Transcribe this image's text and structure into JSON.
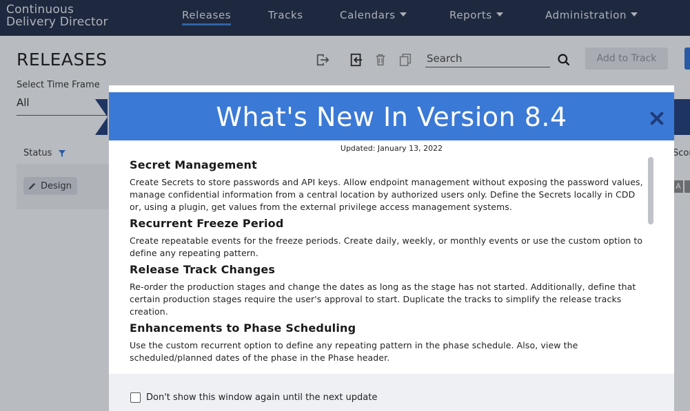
{
  "app": {
    "brand_line1": "Continuous",
    "brand_line2": "Delivery Director"
  },
  "nav": {
    "items": [
      {
        "label": "Releases",
        "active": true
      },
      {
        "label": "Tracks"
      },
      {
        "label": "Calendars",
        "dropdown": true
      },
      {
        "label": "Reports",
        "dropdown": true
      },
      {
        "label": "Administration",
        "dropdown": true
      }
    ]
  },
  "page": {
    "title": "RELEASES",
    "search_placeholder": "Search",
    "add_to_track": "Add to Track",
    "time_frame_label": "Select Time Frame",
    "time_frame_value": "All",
    "status_column": "Status",
    "score_column": "Scor",
    "row_status": "Design",
    "score_badge": "A"
  },
  "modal": {
    "title": "What's New In Version 8.4",
    "updated": "Updated: January 13, 2022",
    "sections": [
      {
        "title": "Secret Management",
        "body": "Create Secrets to store passwords and API keys. Allow endpoint management without exposing the password values, manage confidential information from a central location by authorized users only. Define the Secrets locally in CDD or, using a plugin, get values from the external privilege access management systems."
      },
      {
        "title": "Recurrent Freeze Period",
        "body": "Create repeatable events for the freeze periods. Create daily, weekly, or monthly events or use the custom option to define any repeating pattern."
      },
      {
        "title": "Release Track Changes",
        "body": "Re-order the production stages and change the dates as long as the stage has not started. Additionally, define that certain production stages require the user's approval to start. Duplicate the tracks to simplify the release tracks creation."
      },
      {
        "title": "Enhancements to Phase Scheduling",
        "body": "Use the custom recurrent option to define any repeating pattern in the phase schedule. Also, view the scheduled/planned dates of the phase in the Phase header."
      }
    ],
    "dont_show_label": "Don't show this window again until the next update"
  },
  "colors": {
    "nav_bg": "#1f2a44",
    "modal_header": "#3b79d6",
    "accent": "#2f6fd1"
  },
  "icons": [
    "export-icon",
    "import-icon",
    "trash-icon",
    "copy-icon",
    "search-icon",
    "filter-icon",
    "pencil-icon",
    "close-icon"
  ]
}
